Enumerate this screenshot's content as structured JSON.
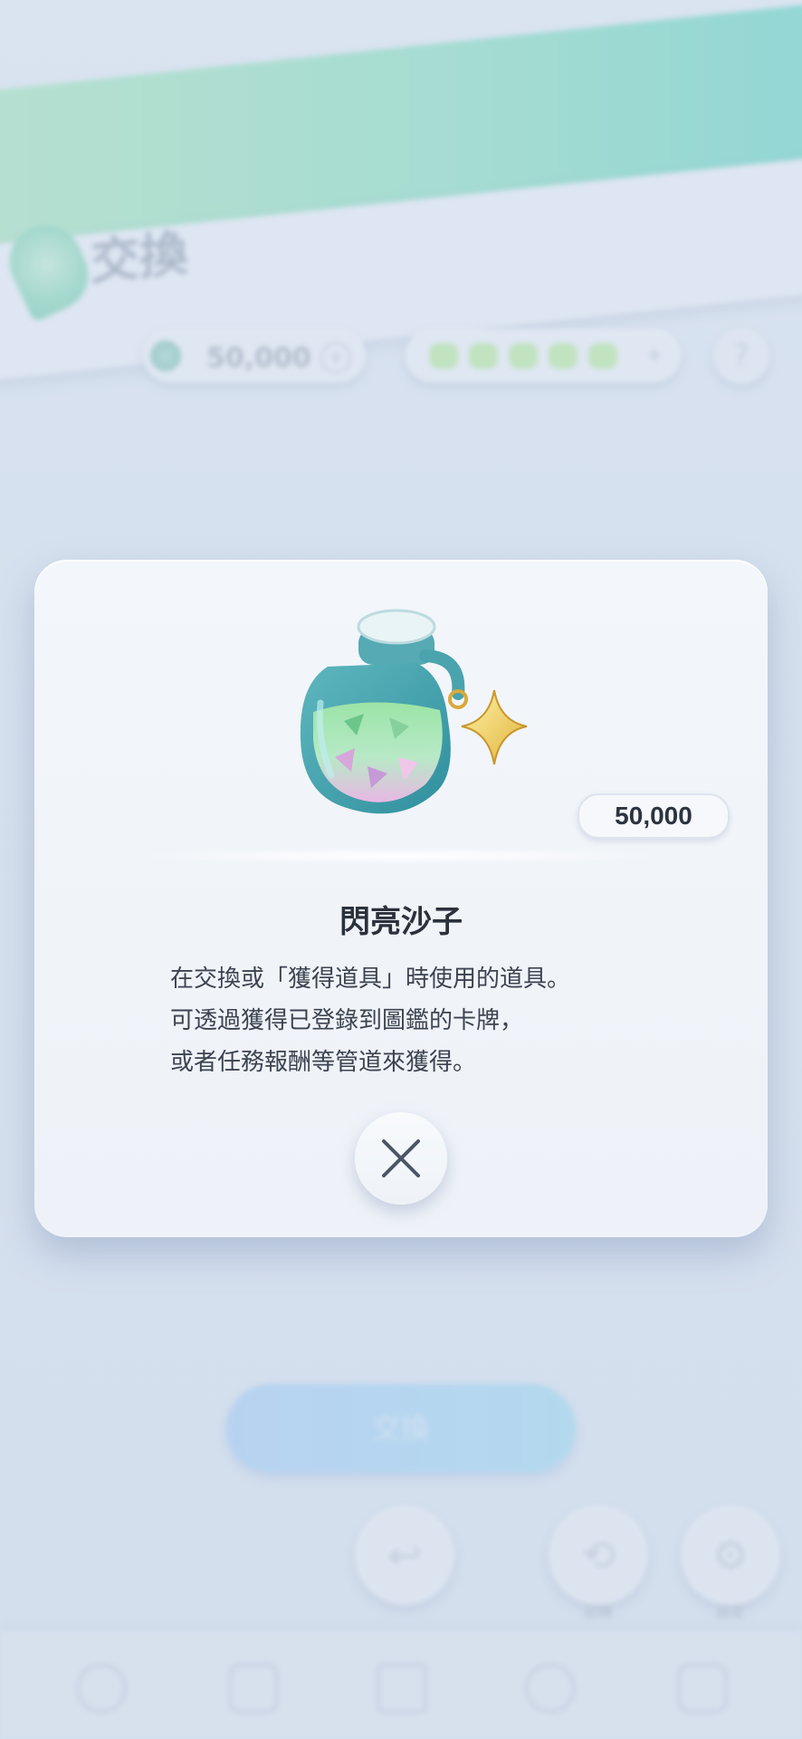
{
  "background": {
    "header_title": "交換",
    "coins": {
      "value": "50,000"
    },
    "exchange_button_label": "交換",
    "history_label": "記錄",
    "settings_label": "設定"
  },
  "modal": {
    "price": "50,000",
    "item_name": "閃亮沙子",
    "description_lines": [
      "在交換或「獲得道具」時使用的道具。",
      "可透過獲得已登錄到圖鑑的卡牌，",
      "或者任務報酬等管道來獲得。"
    ]
  },
  "icons": {
    "item": "shiny-sand-bottle-icon",
    "close": "close-icon",
    "help": "help-icon"
  },
  "colors": {
    "header_gradient_start": "#a9e2c0",
    "header_gradient_end": "#6fd3c7",
    "modal_bg": "#f3f6fa",
    "text_primary": "#2b313c",
    "exchange_button": "#aacdf2"
  }
}
